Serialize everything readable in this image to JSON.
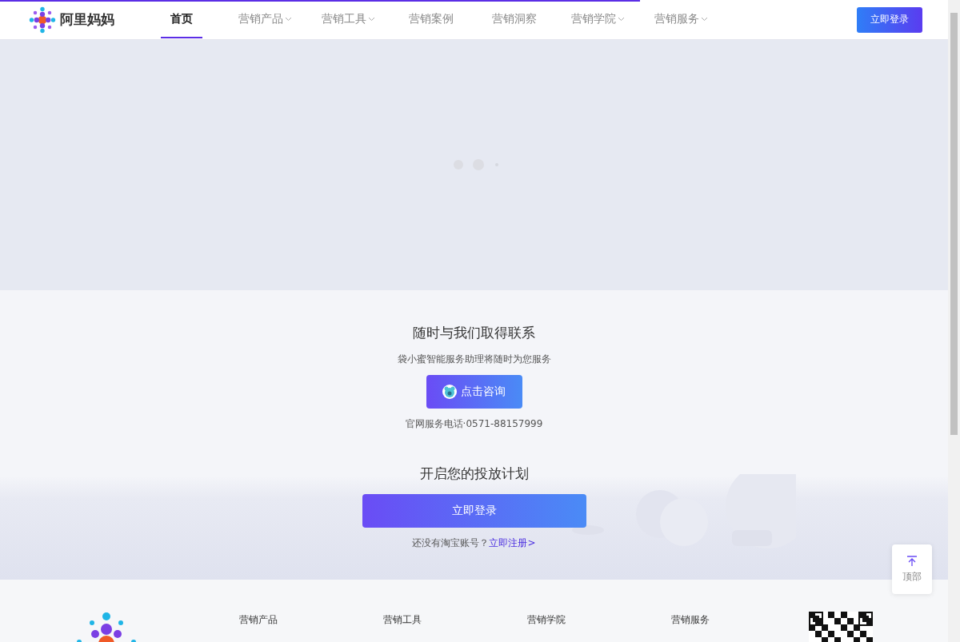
{
  "loading_bar": {
    "level": 0.675
  },
  "header": {
    "logo_text": "阿里妈妈",
    "nav": [
      {
        "label": "首页",
        "selected": true,
        "dropdown": false
      },
      {
        "label": "营销产品",
        "selected": false,
        "dropdown": true
      },
      {
        "label": "营销工具",
        "selected": false,
        "dropdown": true
      },
      {
        "label": "营销案例",
        "selected": false,
        "dropdown": false
      },
      {
        "label": "营销洞察",
        "selected": false,
        "dropdown": false
      },
      {
        "label": "营销学院",
        "selected": false,
        "dropdown": true
      },
      {
        "label": "营销服务",
        "selected": false,
        "dropdown": true
      }
    ],
    "login_button": "立即登录"
  },
  "contact": {
    "title": "随时与我们取得联系",
    "subtitle": "袋小蜜智能服务助理将随时为您服务",
    "consult_button": "点击咨询",
    "phone": "官网服务电话·0571-88157999"
  },
  "plan": {
    "title": "开启您的投放计划",
    "login_button": "立即登录",
    "register_prompt": "还没有淘宝账号？",
    "register_link": "立即注册>"
  },
  "back_to_top": {
    "label": "顶部"
  },
  "footer": {
    "columns": [
      "营销产品",
      "营销工具",
      "营销学院",
      "营销服务"
    ]
  }
}
